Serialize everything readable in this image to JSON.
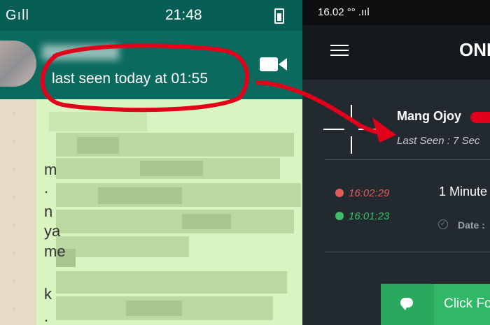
{
  "left_app": {
    "status_bar": {
      "carrier": "Gıll",
      "time": "21:48"
    },
    "header": {
      "last_seen": "last seen today at 01:55"
    },
    "chat_fragments": [
      "m",
      ".",
      "n",
      "ya",
      "me",
      "k",
      "."
    ]
  },
  "right_app": {
    "status_bar": {
      "time": "16.02 °° .ııl"
    },
    "brand": "ONL",
    "contact": {
      "name": "Mang Ojoy",
      "last_seen": "Last Seen : 7 Sec"
    },
    "log": [
      {
        "time": "16:02:29",
        "status_color": "#e15b5b"
      },
      {
        "time": "16:01:23",
        "status_color": "#3fbf6c"
      }
    ],
    "duration": "1 Minute",
    "date_label": "Date :",
    "button_label": "Click Fo"
  },
  "colors": {
    "whatsapp_header": "#075e54",
    "annotation_red": "#e3001b",
    "dark_bg": "#232a2f",
    "green_button": "#30b866"
  },
  "icons": [
    "video-call-icon",
    "menu-icon",
    "crosshair-icon",
    "chat-bubble-icon",
    "check-circle-icon"
  ]
}
